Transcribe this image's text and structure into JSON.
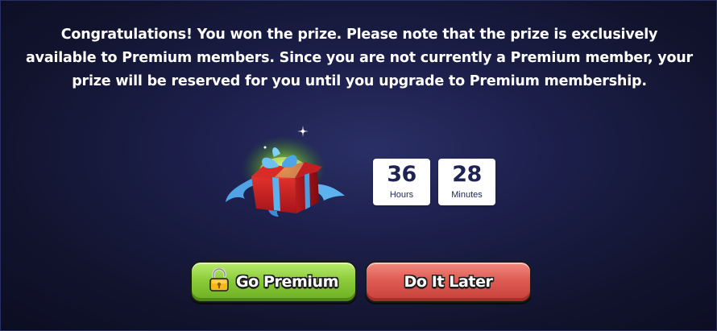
{
  "message": "Congratulations! You won the prize. Please note that the prize is exclusively available to Premium members. Since you are not currently a Premium member, your prize will be reserved for you until you upgrade to Premium membership.",
  "gift": {
    "icon": "gift-box-icon"
  },
  "timer": {
    "hours": {
      "value": "36",
      "unit": "Hours"
    },
    "minutes": {
      "value": "28",
      "unit": "Minutes"
    }
  },
  "buttons": {
    "premium": {
      "label": "Go Premium",
      "icon": "unlocked-padlock-icon",
      "color": "#8ccc3a"
    },
    "later": {
      "label": "Do It Later",
      "color": "#df5c54"
    }
  }
}
